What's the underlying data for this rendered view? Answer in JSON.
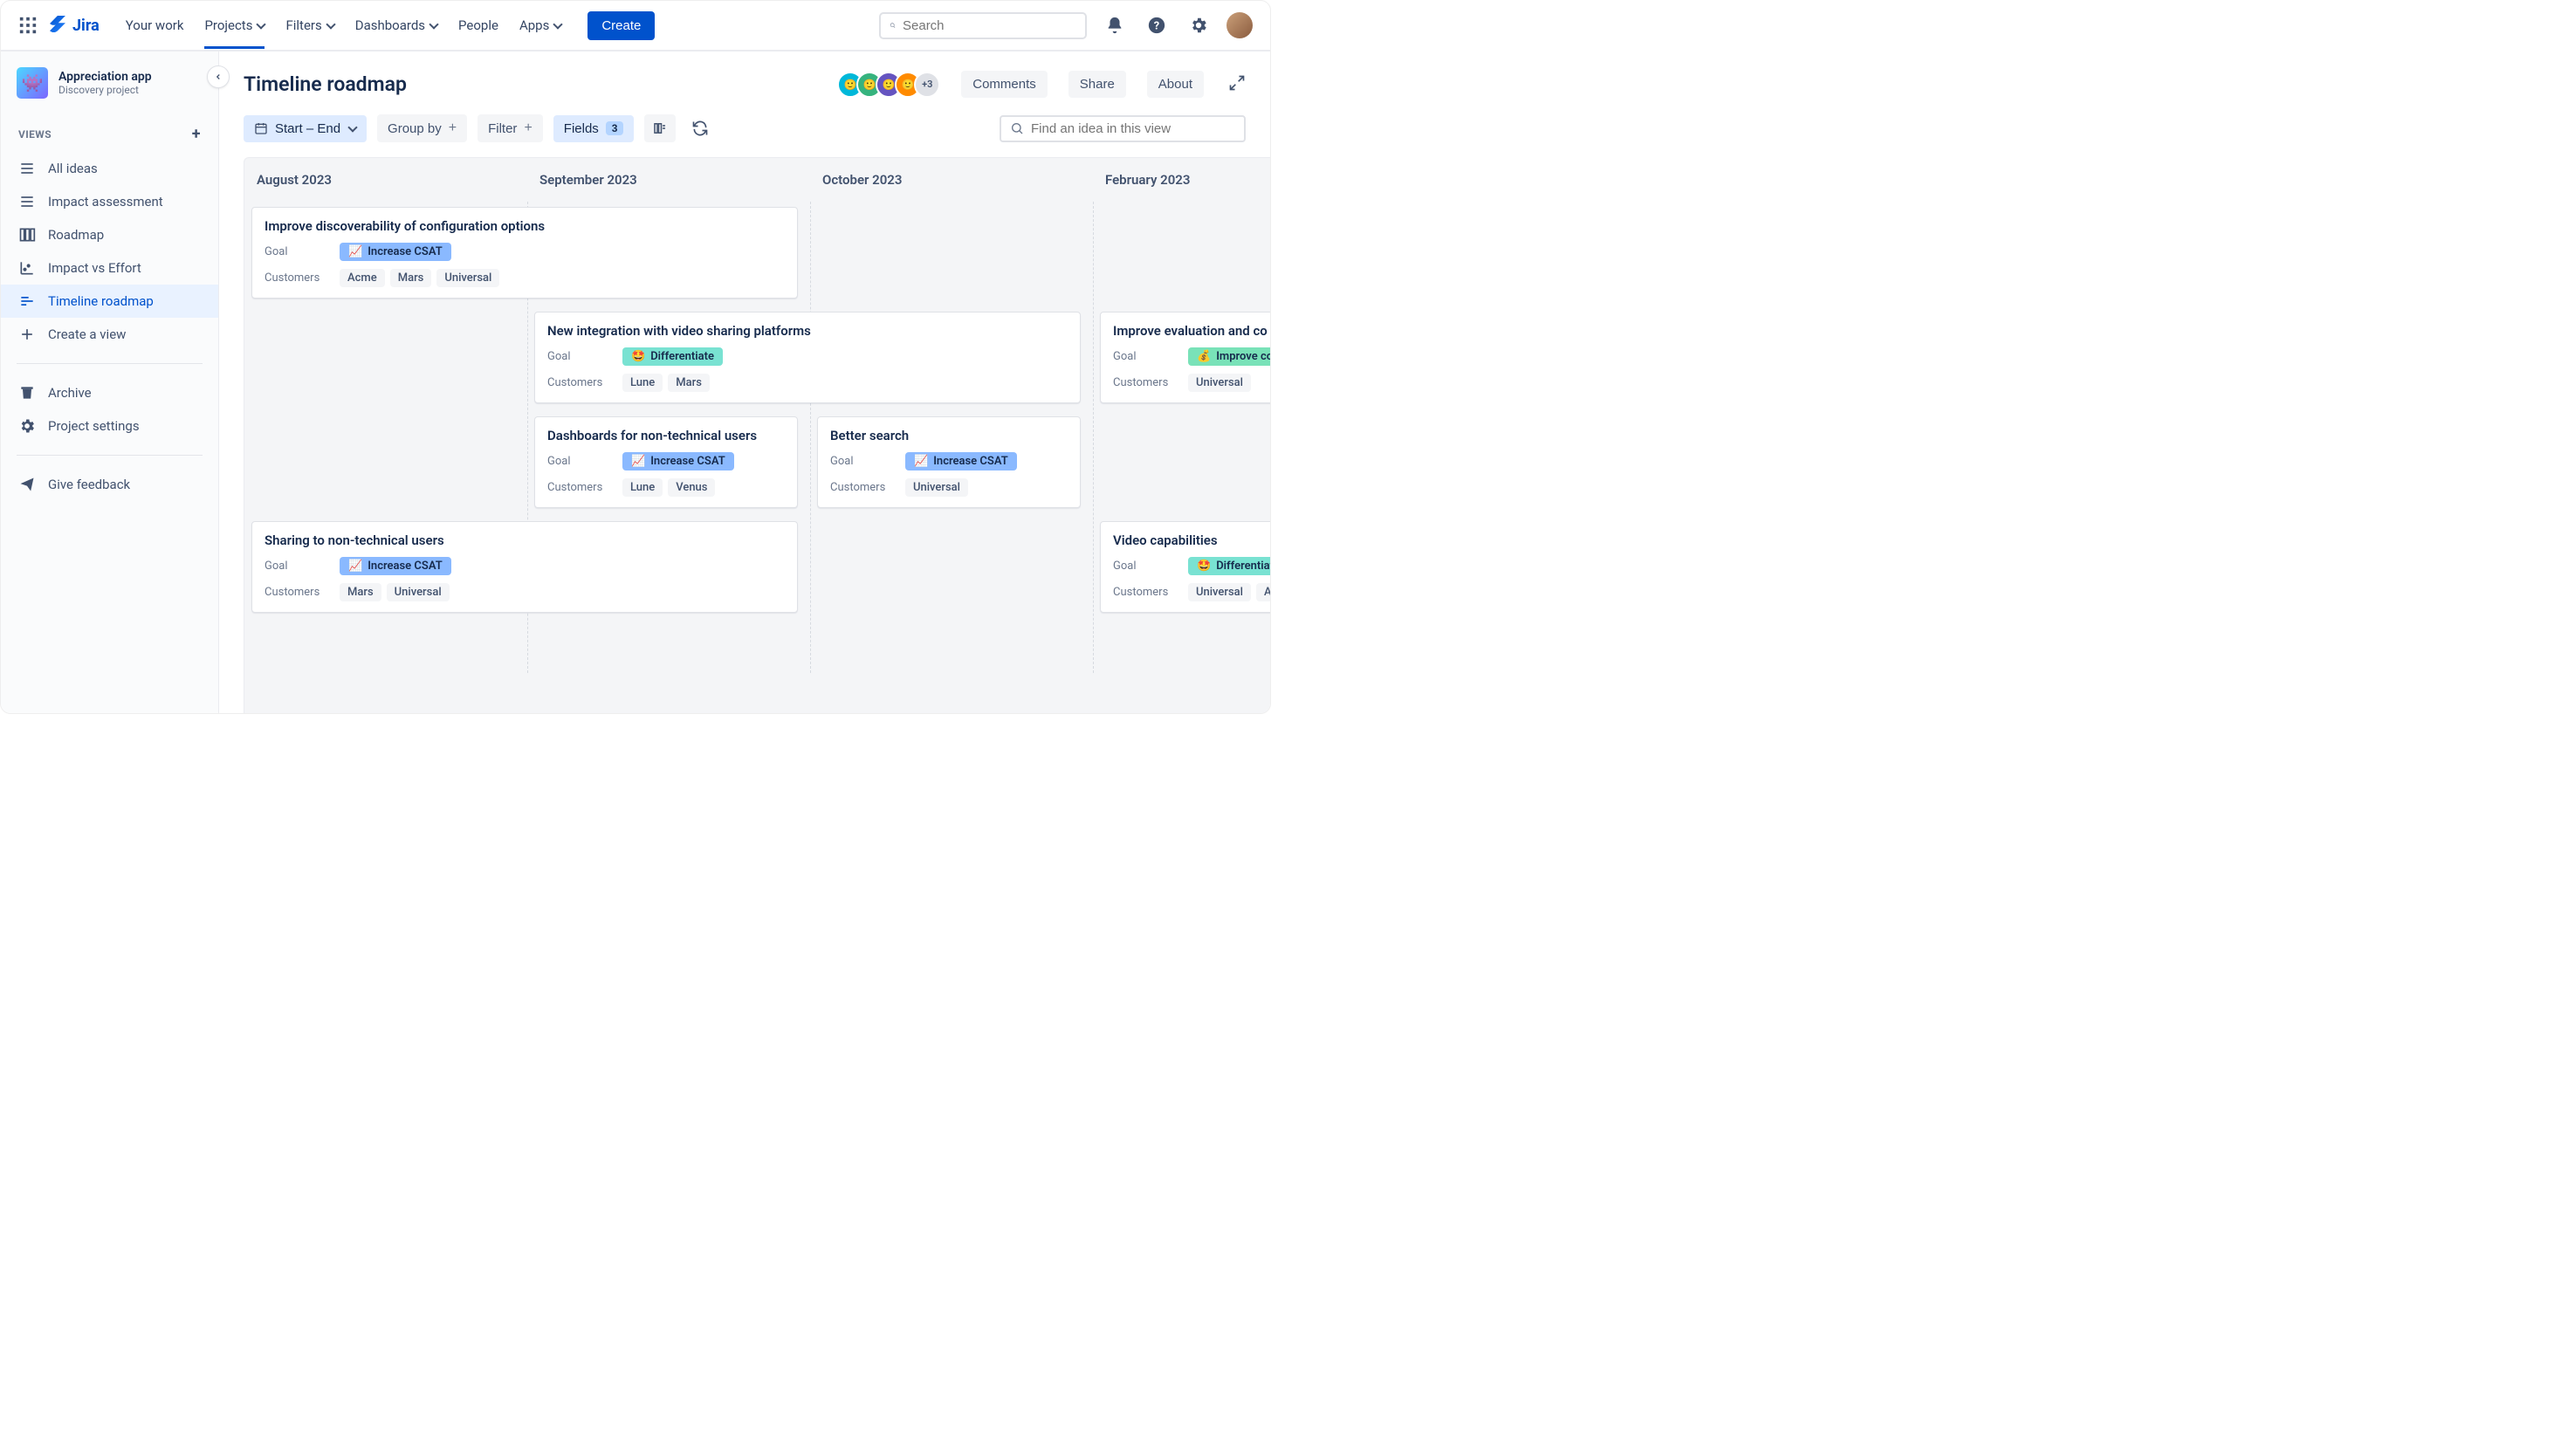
{
  "topnav": {
    "logo": "Jira",
    "links": {
      "your_work": "Your work",
      "projects": "Projects",
      "filters": "Filters",
      "dashboards": "Dashboards",
      "people": "People",
      "apps": "Apps"
    },
    "create": "Create",
    "search_placeholder": "Search"
  },
  "sidebar": {
    "project_name": "Appreciation app",
    "project_sub": "Discovery project",
    "views_label": "VIEWS",
    "items": {
      "all_ideas": "All ideas",
      "impact_assessment": "Impact assessment",
      "roadmap": "Roadmap",
      "impact_vs_effort": "Impact vs Effort",
      "timeline_roadmap": "Timeline roadmap",
      "create_view": "Create a view",
      "archive": "Archive",
      "project_settings": "Project settings",
      "give_feedback": "Give feedback"
    }
  },
  "header": {
    "title": "Timeline roadmap",
    "avatar_more": "+3",
    "comments": "Comments",
    "share": "Share",
    "about": "About"
  },
  "toolbar": {
    "date_range": "Start – End",
    "group_by": "Group by",
    "filter": "Filter",
    "fields": "Fields",
    "fields_count": "3",
    "idea_search_placeholder": "Find an idea in this view"
  },
  "timeline": {
    "cols": [
      "August 2023",
      "September 2023",
      "October 2023",
      "February 2023"
    ],
    "label_goal": "Goal",
    "label_customers": "Customers",
    "goals": {
      "csat": "Increase CSAT",
      "diff": "Differentiate",
      "conv": "Improve co"
    },
    "cards": {
      "c1": {
        "title": "Improve discoverability of configuration options",
        "cust": [
          "Acme",
          "Mars",
          "Universal"
        ]
      },
      "c2": {
        "title": "New integration with video sharing platforms",
        "cust": [
          "Lune",
          "Mars"
        ]
      },
      "c3": {
        "title": "Improve evaluation and co",
        "cust": [
          "Universal"
        ]
      },
      "c4": {
        "title": "Dashboards for non-technical users",
        "cust": [
          "Lune",
          "Venus"
        ]
      },
      "c5": {
        "title": "Better search",
        "cust": [
          "Universal"
        ]
      },
      "c6": {
        "title": "Sharing to non-technical users",
        "cust": [
          "Mars",
          "Universal"
        ]
      },
      "c7": {
        "title": "Video capabilities",
        "cust": [
          "Universal",
          "Acm"
        ]
      }
    }
  }
}
